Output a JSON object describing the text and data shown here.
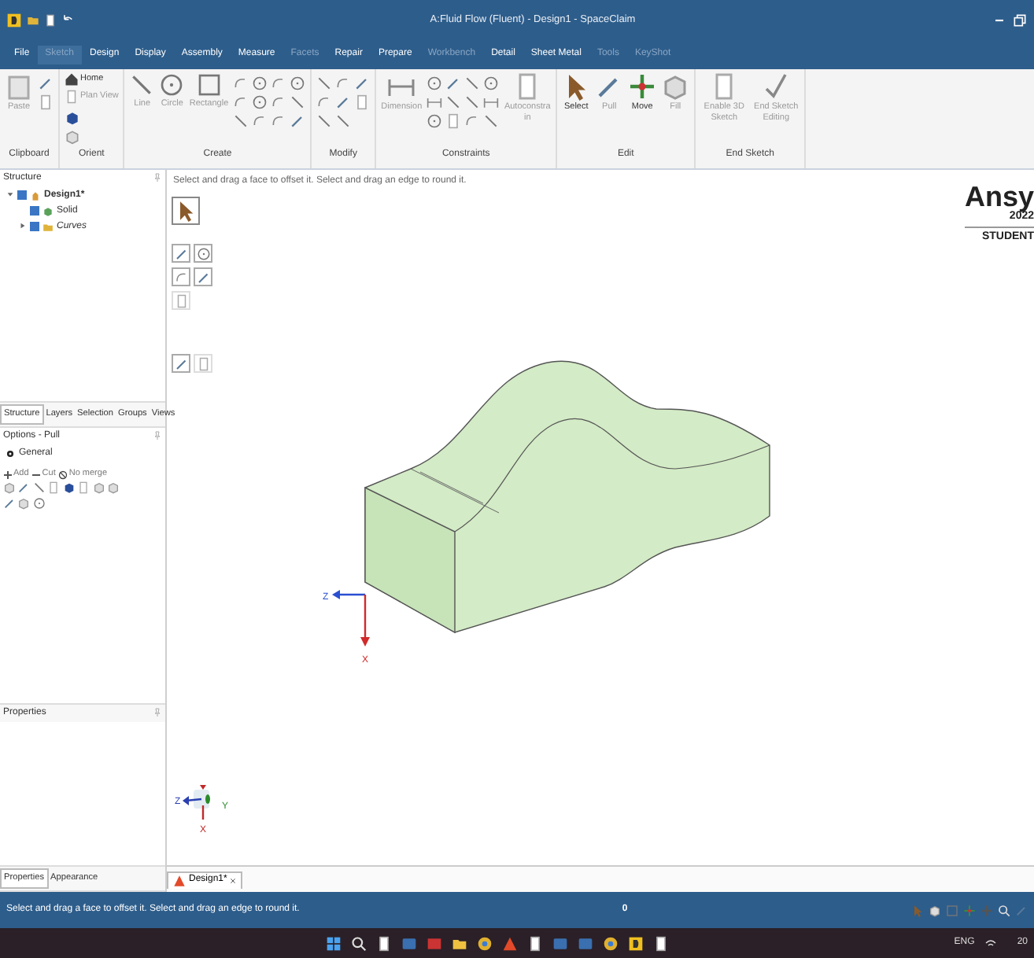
{
  "window": {
    "title": "A:Fluid Flow (Fluent) - Design1 - SpaceClaim"
  },
  "menu_tabs": [
    {
      "label": "File",
      "selected": false,
      "disabled": false
    },
    {
      "label": "Sketch",
      "selected": true,
      "disabled": true
    },
    {
      "label": "Design",
      "selected": false,
      "disabled": false
    },
    {
      "label": "Display",
      "selected": false,
      "disabled": false
    },
    {
      "label": "Assembly",
      "selected": false,
      "disabled": false
    },
    {
      "label": "Measure",
      "selected": false,
      "disabled": false
    },
    {
      "label": "Facets",
      "selected": false,
      "disabled": true
    },
    {
      "label": "Repair",
      "selected": false,
      "disabled": false
    },
    {
      "label": "Prepare",
      "selected": false,
      "disabled": false
    },
    {
      "label": "Workbench",
      "selected": false,
      "disabled": true
    },
    {
      "label": "Detail",
      "selected": false,
      "disabled": false
    },
    {
      "label": "Sheet Metal",
      "selected": false,
      "disabled": false
    },
    {
      "label": "Tools",
      "selected": false,
      "disabled": true
    },
    {
      "label": "KeyShot",
      "selected": false,
      "disabled": true
    }
  ],
  "ribbon": [
    {
      "label": "Clipboard",
      "tools": [
        {
          "label": "Paste",
          "disabled": true
        }
      ]
    },
    {
      "label": "Orient",
      "tools": [
        {
          "label": "Home",
          "disabled": false
        },
        {
          "label": "Plan View",
          "disabled": true
        }
      ]
    },
    {
      "label": "Create",
      "tools": [
        {
          "label": "Line",
          "disabled": true
        },
        {
          "label": "Circle",
          "disabled": true
        },
        {
          "label": "Rectangle",
          "disabled": true
        }
      ]
    },
    {
      "label": "Modify"
    },
    {
      "label": "Constraints",
      "tools": [
        {
          "label": "Dimension",
          "disabled": true
        },
        {
          "label": "Autoconstrain",
          "disabled": true
        }
      ]
    },
    {
      "label": "Edit",
      "tools": [
        {
          "label": "Select",
          "disabled": false
        },
        {
          "label": "Pull",
          "disabled": true
        },
        {
          "label": "Move",
          "disabled": false
        },
        {
          "label": "Fill",
          "disabled": true
        }
      ]
    },
    {
      "label": "End Sketch",
      "tools": [
        {
          "label": "Enable 3D Sketch",
          "disabled": true
        },
        {
          "label": "End Sketch Editing",
          "disabled": true
        }
      ]
    }
  ],
  "structure": {
    "title": "Structure",
    "tree": [
      {
        "label": "Design1*",
        "checked": true,
        "expanded": true,
        "children": [
          {
            "label": "Solid",
            "checked": true
          },
          {
            "label": "Curves",
            "checked": true,
            "expanded": false
          }
        ]
      }
    ]
  },
  "left_tabs": [
    {
      "label": "Structure",
      "selected": true
    },
    {
      "label": "Layers",
      "selected": false
    },
    {
      "label": "Selection",
      "selected": false
    },
    {
      "label": "Groups",
      "selected": false
    },
    {
      "label": "Views",
      "selected": false
    }
  ],
  "options": {
    "title": "Options - Pull",
    "section": "General",
    "modes": [
      {
        "label": "Add"
      },
      {
        "label": "Cut"
      },
      {
        "label": "No merge"
      }
    ]
  },
  "properties": {
    "title": "Properties"
  },
  "bottom_tabs": [
    {
      "label": "Properties",
      "selected": true
    },
    {
      "label": "Appearance",
      "selected": false
    }
  ],
  "viewport": {
    "hint": "Select and drag a face to offset it. Select and drag an edge to round it.",
    "model_axes": [
      "Z",
      "X"
    ],
    "triad_axes": [
      "Z",
      "Y",
      "X"
    ],
    "logo": {
      "name": "Ansy",
      "version": "2022",
      "edition": "STUDENT"
    }
  },
  "document_tabs": [
    {
      "label": "Design1*",
      "selected": true
    }
  ],
  "status_bar": {
    "message": "Select and drag a face to offset it. Select and drag an edge to round it.",
    "selection_count": "0"
  },
  "taskbar": {
    "language": "ENG",
    "clock": "20"
  }
}
